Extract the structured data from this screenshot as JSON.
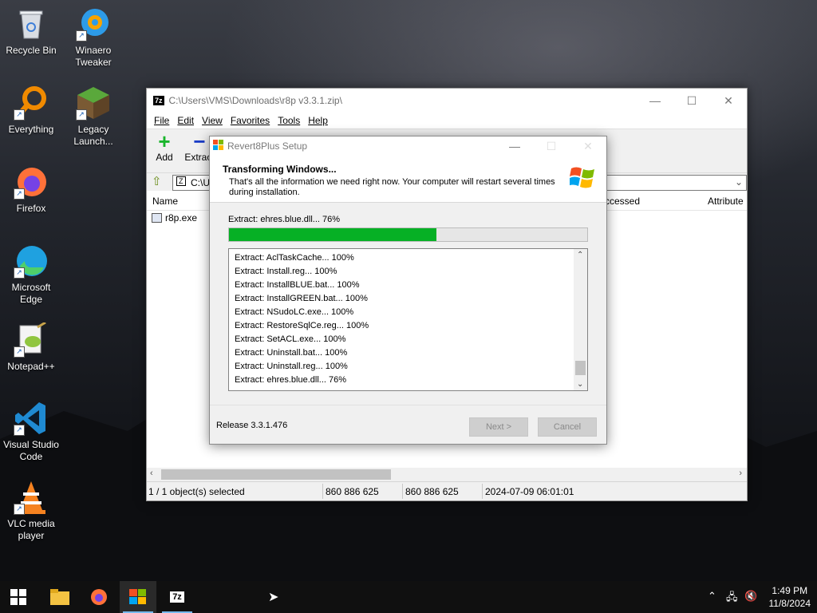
{
  "desktop_icons": [
    {
      "label": "Recycle Bin"
    },
    {
      "label": "Winaero Tweaker"
    },
    {
      "label": "Everything"
    },
    {
      "label": "Legacy Launch..."
    },
    {
      "label": "Firefox"
    },
    {
      "label": "Microsoft Edge"
    },
    {
      "label": "Notepad++"
    },
    {
      "label": "Visual Studio Code"
    },
    {
      "label": "VLC media player"
    }
  ],
  "zip_window": {
    "logo": "7z",
    "title": "C:\\Users\\VMS\\Downloads\\r8p v3.3.1.zip\\",
    "menu": [
      "File",
      "Edit",
      "View",
      "Favorites",
      "Tools",
      "Help"
    ],
    "toolbar": {
      "add": "Add",
      "extract": "Extract"
    },
    "path": "C:\\U",
    "columns": {
      "name": "Name",
      "accessed": "ccessed",
      "attributes": "Attribute"
    },
    "file": {
      "name": "r8p.exe"
    },
    "status": {
      "selection": "1 / 1 object(s) selected",
      "size": "860 886 625",
      "packed": "860 886 625",
      "date": "2024-07-09 06:01:01"
    }
  },
  "setup": {
    "title": "Revert8Plus Setup",
    "heading": "Transforming Windows...",
    "subtext": "That's all the information we need right now. Your computer will restart several times during installation.",
    "current": "Extract: ehres.blue.dll... 76%",
    "progress": 0.58,
    "log": [
      "Extract: AclTaskCache... 100%",
      "Extract: Install.reg... 100%",
      "Extract: InstallBLUE.bat... 100%",
      "Extract: InstallGREEN.bat... 100%",
      "Extract: NSudoLC.exe... 100%",
      "Extract: RestoreSqlCe.reg... 100%",
      "Extract: SetACL.exe... 100%",
      "Extract: Uninstall.bat... 100%",
      "Extract: Uninstall.reg... 100%",
      "Extract: ehres.blue.dll... 76%"
    ],
    "release": "Release 3.3.1.476",
    "next": "Next >",
    "cancel": "Cancel"
  },
  "taskbar": {
    "time": "1:49 PM",
    "date": "11/8/2024"
  },
  "colors": {
    "progress_fill": "#06b025",
    "taskbar": "#101010"
  }
}
